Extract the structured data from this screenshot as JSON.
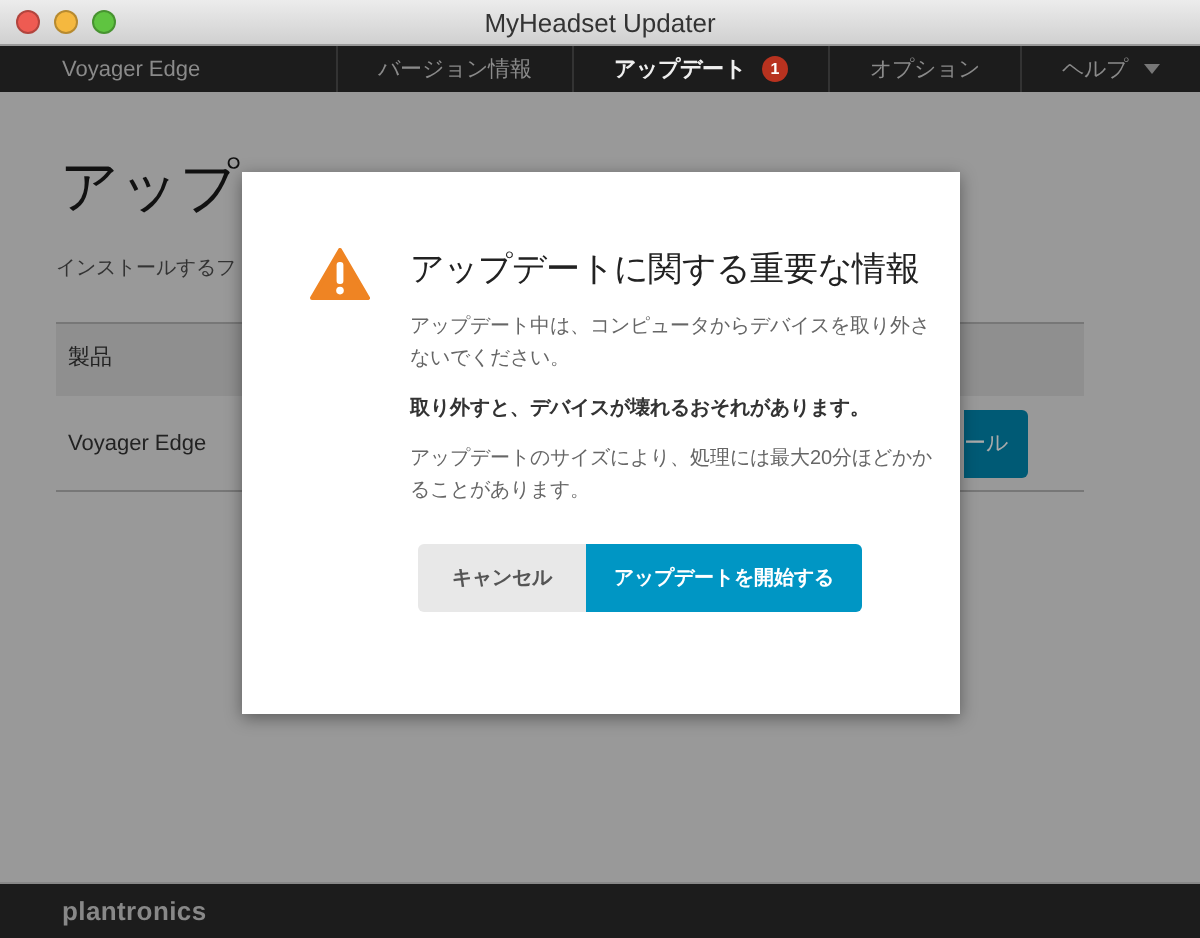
{
  "window": {
    "title": "MyHeadset Updater"
  },
  "nav": {
    "product": "Voyager Edge",
    "tabs": [
      {
        "label": "バージョン情報",
        "selected": false
      },
      {
        "label": "アップデート",
        "selected": true,
        "badge": "1"
      },
      {
        "label": "オプション",
        "selected": false
      },
      {
        "label": "ヘルプ",
        "selected": false,
        "dropdown": true
      }
    ]
  },
  "page": {
    "heading": "アップ",
    "subtitle": "インストールするフ",
    "table": {
      "columns": [
        "製品"
      ],
      "rows": [
        {
          "product": "Voyager Edge",
          "action": "ール"
        }
      ]
    }
  },
  "dialog": {
    "title": "アップデートに関する重要な情報",
    "paragraphs": [
      {
        "text": "アップデート中は、コンピュータからデバイスを取り外さないでください。",
        "bold": false
      },
      {
        "text": "取り外すと、デバイスが壊れるおそれがあります。",
        "bold": true
      },
      {
        "text": "アップデートのサイズにより、処理には最大20分ほどかかることがあります。",
        "bold": false
      }
    ],
    "buttons": [
      {
        "label": "キャンセル",
        "kind": "secondary"
      },
      {
        "label": "アップデートを開始する",
        "kind": "primary"
      }
    ]
  },
  "footer": {
    "logo": "plantronics"
  }
}
